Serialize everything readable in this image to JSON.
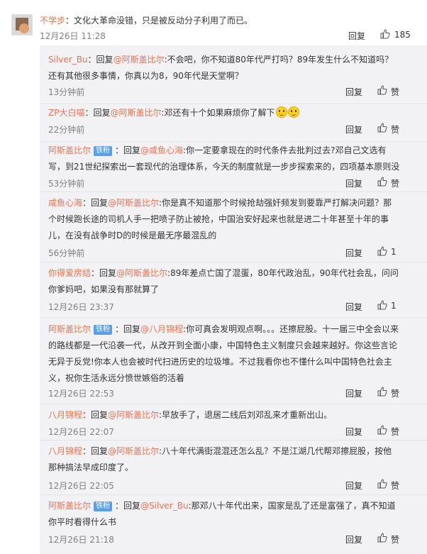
{
  "top_comment": {
    "author": "不学步",
    "text": "：文化大革命没错，只是被反动分子利用了而已。",
    "time": "12月26日 11:28",
    "reply_label": "回复",
    "like_count": "185"
  },
  "replies": [
    {
      "author": "Silver_Bu",
      "prefix": "：回复",
      "target": "@阿斯盖比尔",
      "text": ":不会吧，你不知道80年代严打吗？89年发生什么不知道吗？还有其他很多事情，你真以为8，90年代是天堂啊？",
      "time": "13分钟前",
      "reply_label": "回复",
      "like_label": "赞"
    },
    {
      "author": "ZP大白喵",
      "prefix": "：回复",
      "target": "@阿斯盖比尔",
      "text": ":邓还有十个如果麻烦你了解下",
      "time": "22分钟前",
      "reply_label": "回复",
      "like_label": "赞"
    },
    {
      "author": "阿斯盖比尔",
      "badge": "铁粉",
      "prefix": "：回复",
      "target": "@咸鱼心海",
      "text": ":你一定要拿现在的时代条件去批判过去?邓自己文选有写，到21世纪探索出一套现代的治理体系，今天的制度就是一步步探索来的，四项基本原则没有变",
      "time": "53分钟前",
      "reply_label": "回复",
      "like_label": "赞"
    },
    {
      "author": "咸鱼心海",
      "prefix": "：回复",
      "target": "@阿斯盖比尔",
      "text": ":你是真不知道那个时候抢劫强奸频发到要靠严打解决问题？那个时候跑长途的司机人手一把喷子防止被抢，中国治安好起来也就是进二十年甚至十年的事儿，在没有战争时D的时候是最无序最混乱的",
      "time": "56分钟前",
      "reply_label": "回复",
      "like_label": "1"
    },
    {
      "author": "你得爱房结",
      "prefix": "：回复",
      "target": "@阿斯盖比尔",
      "text": ":89年差点亡国了混蛋，80年代政治乱，90年代社会乱，问问你爹妈吧，如果没有那就算了",
      "time": "12月26日 23:37",
      "reply_label": "回复",
      "like_label": "1"
    },
    {
      "author": "阿斯盖比尔",
      "badge": "铁粉",
      "prefix": "：回复",
      "target": "@八月锦程",
      "text": ":你可真会发明观点啊。。。还擦屁股。十一届三中全会以来的路线都是一代沿袭一代，从改开到全面小康，中国特色主义制度只会越来越好。你这些言论无异于反党!你本人也会被时代扫进历史的垃圾堆。不过我看你也不懂什么叫中国特色社会主义，祝你生活永远分愤世嫉俗的活着",
      "time": "12月26日 22:53",
      "reply_label": "回复",
      "like_label": "赞"
    },
    {
      "author": "八月锦程",
      "prefix": "：回复",
      "target": "@阿斯盖比尔",
      "text": ":早放手了，退居二线后刘邓乱来才重新出山。",
      "time": "12月26日 22:07",
      "reply_label": "回复",
      "like_label": "赞"
    },
    {
      "author": "八月锦程",
      "prefix": "：回复",
      "target": "@阿斯盖比尔",
      "text": ":八十年代满街混混还怎么乱？不是江湖几代帮邓擦屁股，按他那种搞法早成印度了。",
      "time": "12月26日 22:05",
      "reply_label": "回复",
      "like_label": "赞"
    },
    {
      "author": "阿斯盖比尔",
      "badge": "铁粉",
      "prefix": "：回复",
      "target": "@Silver_Bu",
      "text": ":那邓八十年代出来，国家是乱了还是富强了，真不知道你平时看得什么书",
      "time": "12月26日 21:18",
      "reply_label": "回复",
      "like_label": "赞"
    }
  ],
  "colors": {
    "author": "#eb7350",
    "badge": "#5a9fe8",
    "sub_background": "#f2f2f5",
    "time": "#808080"
  },
  "icons": {
    "like": "thumbs-up-icon",
    "emoji": "smile-emoji-icon"
  }
}
